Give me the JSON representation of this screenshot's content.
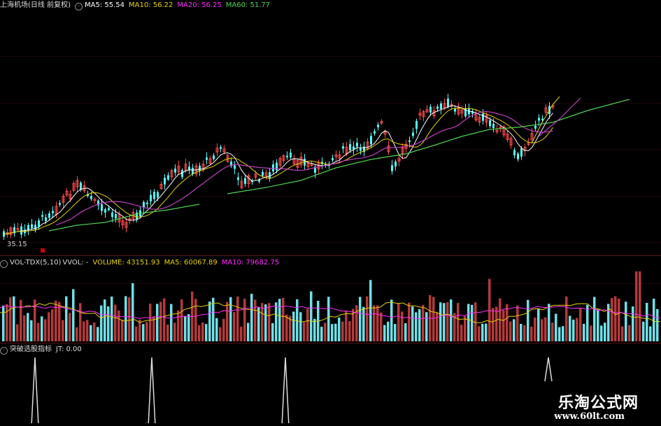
{
  "main": {
    "title": "上海机场(日线 前复权)",
    "indicators": [
      {
        "label": "MA5: 55.54",
        "color": "#ffffff"
      },
      {
        "label": "MA10: 56.22",
        "color": "#e6d200"
      },
      {
        "label": "MA20: 56.25",
        "color": "#ff2cff"
      },
      {
        "label": "MA60: 51.77",
        "color": "#4fd24f"
      }
    ],
    "low_price_label": "35.15",
    "colors": {
      "up": "#ff4a4a",
      "down": "#54fcfc",
      "ma5": "#ffffff",
      "ma10": "#e6d200",
      "ma20": "#c040c0",
      "ma60": "#4fd24f"
    }
  },
  "volume": {
    "title": "VOL-TDX(5,10)",
    "vvol": "VVOL: -",
    "volume": "VOLUME: 43151.93",
    "ma5": "MA5: 60067.89",
    "ma10": "MA10: 79682.75",
    "colors": {
      "up": "#b53a3a",
      "down": "#6fe0e8"
    }
  },
  "signal": {
    "title": "突破选股指标",
    "jt": "JT: 0.00"
  },
  "watermark": {
    "name": "乐淘公式网",
    "url": "www.60lt.com"
  }
}
